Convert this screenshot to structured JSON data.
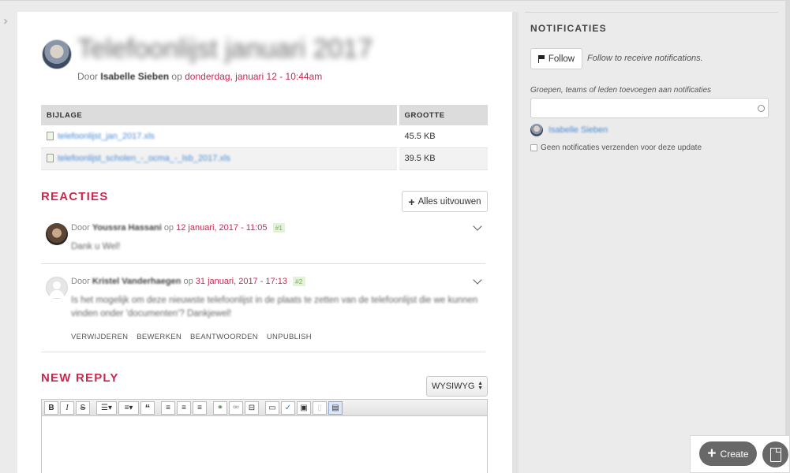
{
  "header": {
    "title": "Telefoonlijst januari 2017",
    "by_prefix": "Door",
    "author": "Isabelle Sieben",
    "on_word": "op",
    "date": "donderdag, januari 12 - 10:44am"
  },
  "attachments": {
    "col_file": "BIJLAGE",
    "col_size": "GROOTTE",
    "rows": [
      {
        "name": "telefoonlijst_jan_2017.xls",
        "size": "45.5 KB"
      },
      {
        "name": "telefoonlijst_scholen_-_ocma_-_lsb_2017.xls",
        "size": "39.5 KB"
      }
    ]
  },
  "comments_section": {
    "title": "REACTIES",
    "expand_all": "Alles uitvouwen",
    "comments": [
      {
        "by_prefix": "Door",
        "author": "Youssra Hassani",
        "on_word": "op",
        "date": "12 januari, 2017 - 11:05",
        "number": "#1",
        "body": "Dank u Wel!"
      },
      {
        "by_prefix": "Door",
        "author": "Kristel Vanderhaegen",
        "on_word": "op",
        "date": "31 januari, 2017 - 17:13",
        "number": "#2",
        "body": "Is het mogelijk om deze nieuwste telefoonlijst in de plaats te zetten van de telefoonlijst die we kunnen vinden onder 'documenten'? Dankjewel!",
        "actions": {
          "delete": "VERWIJDEREN",
          "edit": "BEWERKEN",
          "reply": "BEANTWOORDEN",
          "unpublish": "UNPUBLISH"
        }
      }
    ]
  },
  "reply": {
    "title": "NEW REPLY",
    "editor_mode": "WYSIWYG"
  },
  "sidebar": {
    "title": "NOTIFICATIES",
    "follow_label": "Follow",
    "follow_hint": "Follow to receive notifications.",
    "groups_label": "Groepen, teams of leden toevoegen aan notificaties",
    "groups_placeholder": "",
    "member_name": "Isabelle Sieben",
    "no_notify_label": "Geen notificaties verzenden voor deze update"
  },
  "floating": {
    "create_label": "Create"
  },
  "colors": {
    "accent": "#c9284f",
    "link": "#4a8ad4",
    "button_dark": "#686868"
  }
}
